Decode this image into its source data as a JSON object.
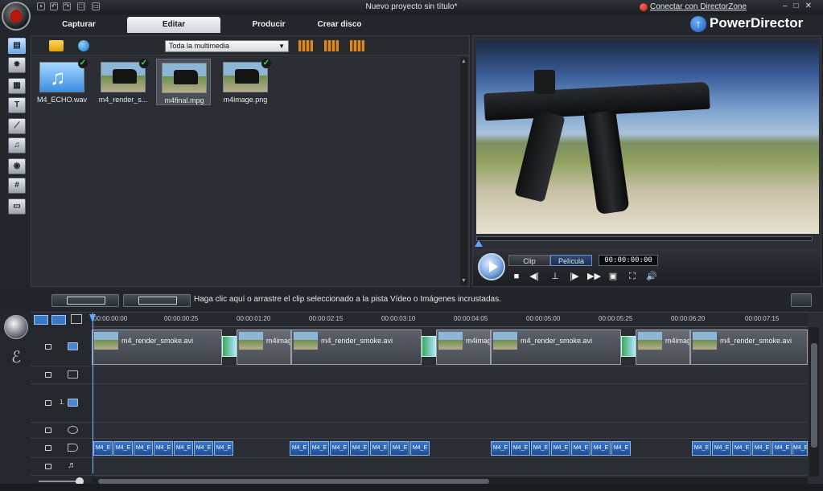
{
  "window": {
    "title": "Nuevo proyecto sin título*",
    "connect_label": "Conectar con DirectorZone",
    "brand": "PowerDirector"
  },
  "tabs": [
    "Capturar",
    "Editar",
    "Producir",
    "Crear disco"
  ],
  "active_tab": "Editar",
  "library": {
    "filter_value": "Toda la multimedia",
    "items": [
      {
        "name": "M4_ECHO.wav",
        "kind": "audio",
        "in_use": true
      },
      {
        "name": "m4_render_s...",
        "kind": "video",
        "in_use": true
      },
      {
        "name": "m4final.mpg",
        "kind": "video",
        "in_use": false,
        "selected": true
      },
      {
        "name": "m4image.png",
        "kind": "image",
        "in_use": true
      }
    ]
  },
  "preview": {
    "modes": [
      "Clip",
      "Película"
    ],
    "active_mode": "Película",
    "timecode": "00:00:00:00"
  },
  "hint": "Haga clic aquí o arrastre el clip seleccionado a la pista Vídeo o Imágenes incrustadas.",
  "timeline": {
    "ruler": [
      "00:00:00:00",
      "00:00:00:25",
      "00:00:01:20",
      "00:00:02:15",
      "00:00:03:10",
      "00:00:04:05",
      "00:00:05:00",
      "00:00:05:25",
      "00:00:06:20",
      "00:00:07:15"
    ],
    "track_number": "1.",
    "video_clips": [
      {
        "name": "m4_render_smoke.avi"
      },
      {
        "name": "m4imag"
      },
      {
        "name": "m4_render_smoke.avi"
      },
      {
        "name": "m4imag"
      },
      {
        "name": "m4_render_smoke.avi"
      },
      {
        "name": "m4imag"
      },
      {
        "name": "m4_render_smoke.avi"
      }
    ],
    "audio_clip_label": "M4_E"
  },
  "colors": {
    "accent": "#5aa9ff",
    "panel": "#2b2e34",
    "audio_clip": "#3d77c9"
  }
}
